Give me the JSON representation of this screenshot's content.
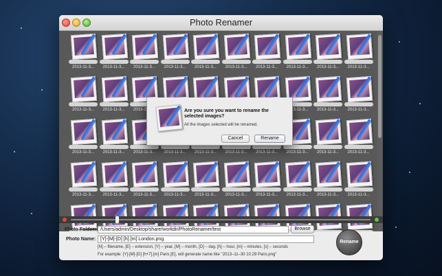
{
  "window": {
    "title": "Photo Renamer"
  },
  "thumbnail_label": "2013-11-3...",
  "dialog": {
    "title": "Are you sure you want to rename the selected images?",
    "message": "All the images selected will be renamed.",
    "cancel": "Cancel",
    "rename": "Rename"
  },
  "controls": {
    "folder_label": "Photo Folder:",
    "folder_value": "/Users/admin/Desktop/share/workdir/PhotoRenamer/test",
    "browse": "Browse",
    "name_label": "Photo Name:",
    "name_value": "[Y]-[M]-[D] [h].[m] London.png",
    "hint1": "[N] – filename, [E] – extension, [Y] – year, [M] – month, [D] – day, [h] – hour, [m] – minutes, [s] – seconds",
    "hint2": "For example: [Y]-[M]-[D] [h+7].[m] Paris.[E],  will generate name like \"2013–11–30 10.29 Paris.png\"",
    "rename_button": "Rename"
  },
  "slider": {
    "position": 0.15
  },
  "colors": {
    "close": "#e0443a",
    "minimize": "#e0a628",
    "maximize": "#4ead35"
  }
}
